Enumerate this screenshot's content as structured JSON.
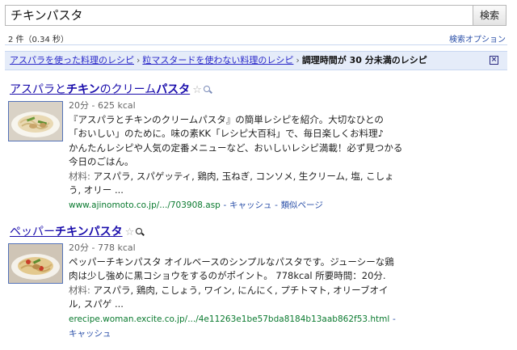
{
  "search": {
    "query": "チキンパスタ",
    "button_label": "検索"
  },
  "stats": {
    "text": "2 件（0.34 秒）",
    "options_label": "検索オプション"
  },
  "breadcrumb": {
    "items": [
      "アスパラを使った料理のレシピ",
      "粒マスタードを使わない料理のレシピ"
    ],
    "separator": "›",
    "current": "調理時間が 30 分未満のレシピ",
    "close_label": "×"
  },
  "results": [
    {
      "title_pre": "アスパラと",
      "title_hl1": "チキン",
      "title_mid": "のクリーム",
      "title_hl2": "パスタ",
      "meta": "20分 - 625 kcal",
      "desc_1": "『アスパラとチキンのクリームパスタ』の簡単レシピを紹介。大切なひとの",
      "desc_2": "「おいしい」のために。味の素KK「レシピ大百科」で、毎日楽しくお料理♪",
      "desc_3": "かんたんレシピや人気の定番メニューなど、おいしいレシピ満載！必ず見つかる",
      "desc_4": "今日のごはん。",
      "ing_label": "材料:",
      "ing_1": "アスパラ, スパゲッティ, 鶏肉, 玉ねぎ, コンソメ, 生クリーム, 塩, こしょ",
      "ing_2": "う, オリー ...",
      "url": "www.ajinomoto.co.jp/.../703908.asp",
      "cache": "キャッシュ",
      "similar": "類似ページ"
    },
    {
      "title_pre": "ペッパー",
      "title_hl1": "チキンパスタ",
      "meta": "20分 - 778 kcal",
      "desc_1": "ペッパーチキンパスタ オイルベースのシンプルなパスタです。ジューシーな鶏",
      "desc_2": "肉は少し強めに黒コショウをするのがポイント。 778kcal 所要時間：20分.",
      "ing_label": "材料:",
      "ing_1": "アスパラ, 鶏肉, こしょう, ワイン, にんにく, プチトマト, オリーブオイ",
      "ing_2": "ル, スパゲ ...",
      "url": "erecipe.woman.excite.co.jp/.../4e11263e1be57bda8184b13aab862f53.html",
      "cache": "キャッシュ"
    }
  ]
}
